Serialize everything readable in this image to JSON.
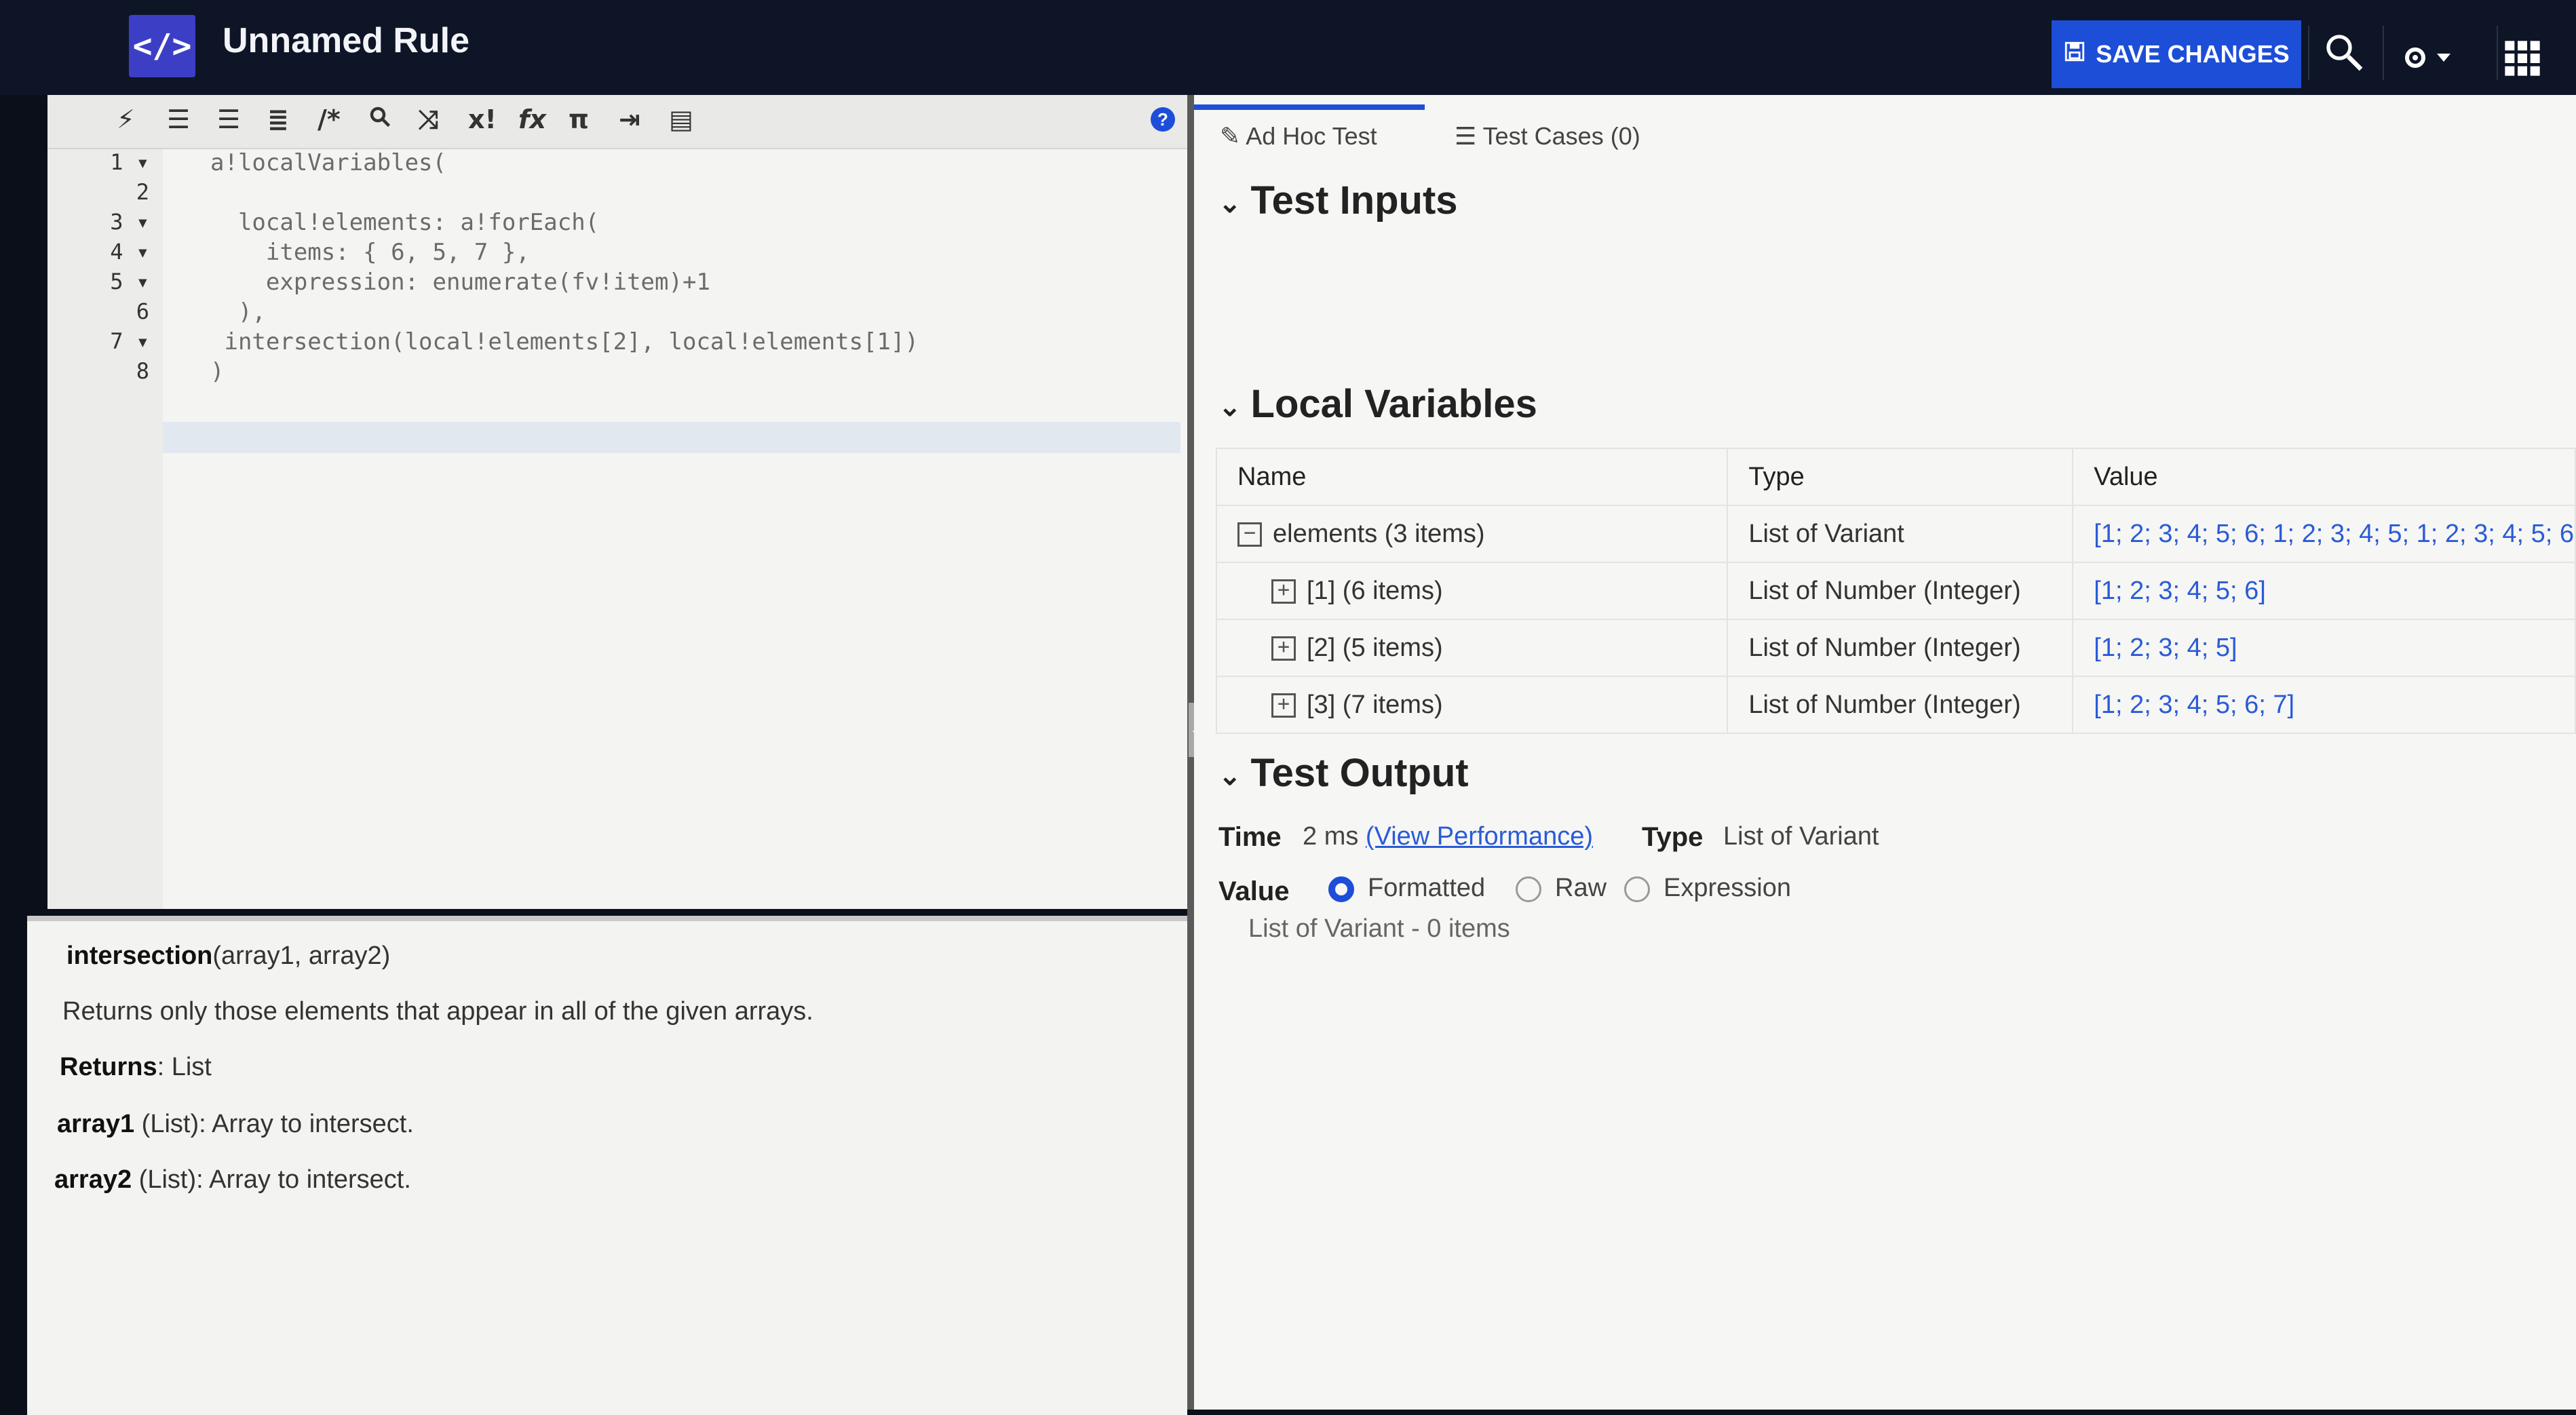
{
  "header": {
    "logo_glyph": "</>",
    "title": "Unnamed Rule",
    "save_label": "SAVE CHANGES",
    "icons": [
      "save-icon",
      "find-icon",
      "settings-icon",
      "apps-grid-icon"
    ]
  },
  "editor": {
    "lines": [
      {
        "num": "1",
        "fold": true,
        "text": "a!localVariables("
      },
      {
        "num": "2",
        "fold": false,
        "text": ""
      },
      {
        "num": "3",
        "fold": true,
        "text": "  local!elements: a!forEach("
      },
      {
        "num": "4",
        "fold": true,
        "text": "    items: { 6, 5, 7 },"
      },
      {
        "num": "5",
        "fold": true,
        "text": "    expression: enumerate(fv!item)+1"
      },
      {
        "num": "6",
        "fold": false,
        "text": "  ),"
      },
      {
        "num": "7",
        "fold": true,
        "text": " intersection(local!elements[2], local!elements[1])"
      },
      {
        "num": "8",
        "fold": false,
        "text": ")"
      }
    ],
    "toolbar_icons": [
      "magic-wand-icon",
      "outdent-icon",
      "indent-icon",
      "format-icon",
      "comment-icon",
      "search-icon",
      "shuffle-icon",
      "variable-icon",
      "function-icon",
      "pi-icon",
      "export-icon",
      "inspect-icon"
    ]
  },
  "docs": {
    "signature_name": "intersection",
    "signature_args": "(array1, array2)",
    "description": "Returns only those elements that appear in all of the given arrays.",
    "returns_label": "Returns",
    "returns_value": ": List",
    "params": [
      {
        "name": "array1",
        "desc": " (List): Array to intersect."
      },
      {
        "name": "array2",
        "desc": " (List): Array to intersect."
      }
    ]
  },
  "tabs": [
    {
      "label": "Ad Hoc Test",
      "active": true
    },
    {
      "label": "Test Cases (0)",
      "active": false
    }
  ],
  "sections": {
    "test_inputs": "Test Inputs",
    "local_variables": "Local Variables",
    "test_output": "Test Output"
  },
  "local_vars": {
    "headers": [
      "Name",
      "Type",
      "Value"
    ],
    "rows": [
      {
        "expander": "−",
        "name": "elements (3 items)",
        "type": "List of Variant",
        "value": "[1; 2; 3; 4; 5; 6; 1; 2; 3; 4; 5; 1; 2; 3; 4; 5; 6",
        "indent": 0
      },
      {
        "expander": "+",
        "name": "[1] (6 items)",
        "type": "List of Number (Integer)",
        "value": "[1; 2; 3; 4; 5; 6]",
        "indent": 1
      },
      {
        "expander": "+",
        "name": "[2] (5 items)",
        "type": "List of Number (Integer)",
        "value": "[1; 2; 3; 4; 5]",
        "indent": 1
      },
      {
        "expander": "+",
        "name": "[3] (7 items)",
        "type": "List of Number (Integer)",
        "value": "[1; 2; 3; 4; 5; 6; 7]",
        "indent": 1
      }
    ]
  },
  "test_output": {
    "time_label": "Time",
    "time_value": "2 ms",
    "view_performance": "(View Performance)",
    "type_label": "Type",
    "type_value": "List of Variant",
    "value_label": "Value",
    "options": [
      "Formatted",
      "Raw",
      "Expression"
    ],
    "selected": "Formatted",
    "result": "List of Variant - 0 items"
  },
  "colors": {
    "accent": "#1d4ed8",
    "header_bg": "#0e1526",
    "link": "#2a5bd7"
  }
}
